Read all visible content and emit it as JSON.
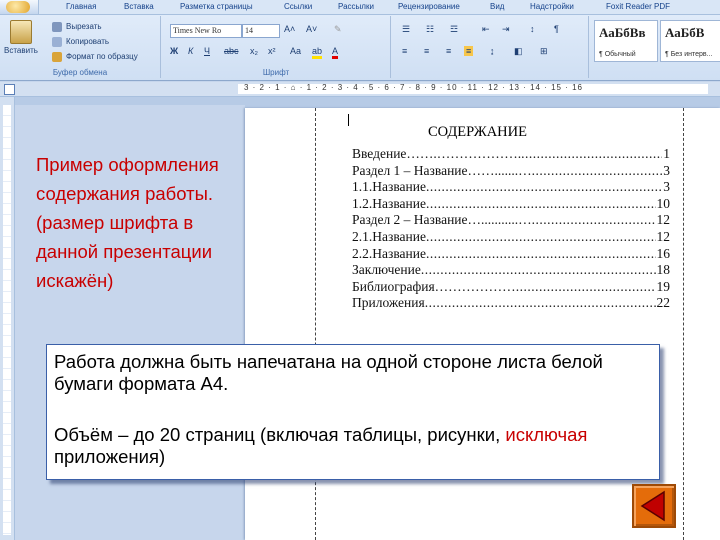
{
  "ribbon": {
    "tabs": [
      "Главная",
      "Вставка",
      "Разметка страницы",
      "Ссылки",
      "Рассылки",
      "Рецензирование",
      "Вид",
      "Надстройки",
      "Foxit Reader PDF"
    ],
    "clipboard": {
      "paste_label": "Вставить",
      "cut_label": "Вырезать",
      "copy_label": "Копировать",
      "format_label": "Формат по образцу",
      "group_label": "Буфер обмена"
    },
    "font": {
      "font_name": "Times New Ro",
      "font_size": "14",
      "group_label": "Шрифт"
    },
    "paragraph": {
      "font_name2": "Times New R"
    },
    "styles": [
      {
        "sample": "АаБбВв",
        "name": "¶ Обычный"
      },
      {
        "sample": "АаБбВ",
        "name": "¶ Без интерв..."
      }
    ],
    "icons": {
      "office": "office-logo-icon",
      "cut": "scissors-icon",
      "copy": "copy-icon",
      "format": "format-painter-icon",
      "paste": "clipboard-icon"
    }
  },
  "ruler": {
    "numbers": "3 · 2 · 1 · ⌂ · 1 · 2 · 3 · 4 · 5 · 6 · 7 · 8 · 9 · 10 · 11 · 12 · 13 · 14 · 15 · 16"
  },
  "slide": {
    "note": "Пример оформления\nсодержания работы.\n(размер шрифта в\nданной презентации\nискажён)",
    "req_line1": "Работа должна быть напечатана на одной стороне листа белой бумаги формата А4.",
    "req_part1": "Объём  – до 20 страниц (включая таблицы, рисунки, ",
    "req_highlight": "исключая",
    "req_part2": " приложения)"
  },
  "document": {
    "toc_title": "СОДЕРЖАНИЕ",
    "toc": [
      {
        "text": "Введение…….……………….",
        "page": "1"
      },
      {
        "text": "Раздел 1 – Название…….......…",
        "page": "3"
      },
      {
        "text": "1.1.Название",
        "page": "3"
      },
      {
        "text": "1.2.Название",
        "page": "10"
      },
      {
        "text": "Раздел 2 – Название…...........…",
        "page": "12"
      },
      {
        "text": "2.1.Название",
        "page": "12"
      },
      {
        "text": "2.2.Название",
        "page": "16"
      },
      {
        "text": "Заключение",
        "page": "18"
      },
      {
        "text": "Библиография………………",
        "page": "19"
      },
      {
        "text": "Приложения",
        "page": "22"
      }
    ]
  },
  "nav": {
    "prev_icon": "triangle-left-icon",
    "color": "#e46c0a"
  }
}
